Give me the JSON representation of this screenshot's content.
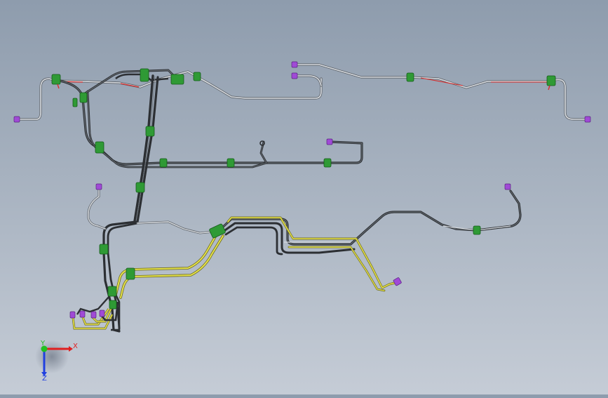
{
  "viewport": {
    "background_top": "#8e9cad",
    "background_bottom": "#c5ccd6"
  },
  "colors": {
    "black_tube": "#2c2f33",
    "black_tube_hi": "#6d747b",
    "silver_tube": "#d7dbe0",
    "silver_tube_edge": "#5e6369",
    "yellow_tube": "#e3e04a",
    "yellow_tube_edge": "#6d6a1c",
    "clip_green": "#2f9a35",
    "clip_green_dark": "#155a1a",
    "connector_purple": "#a04ad6",
    "red_accent": "#d82c2c"
  },
  "triad": {
    "x_label": "X",
    "y_label": "Y",
    "z_label": "Z",
    "x_color": "#e02020",
    "y_color": "#20c020",
    "z_color": "#2040e0",
    "icon": "coordinate-axes-triad-icon"
  }
}
